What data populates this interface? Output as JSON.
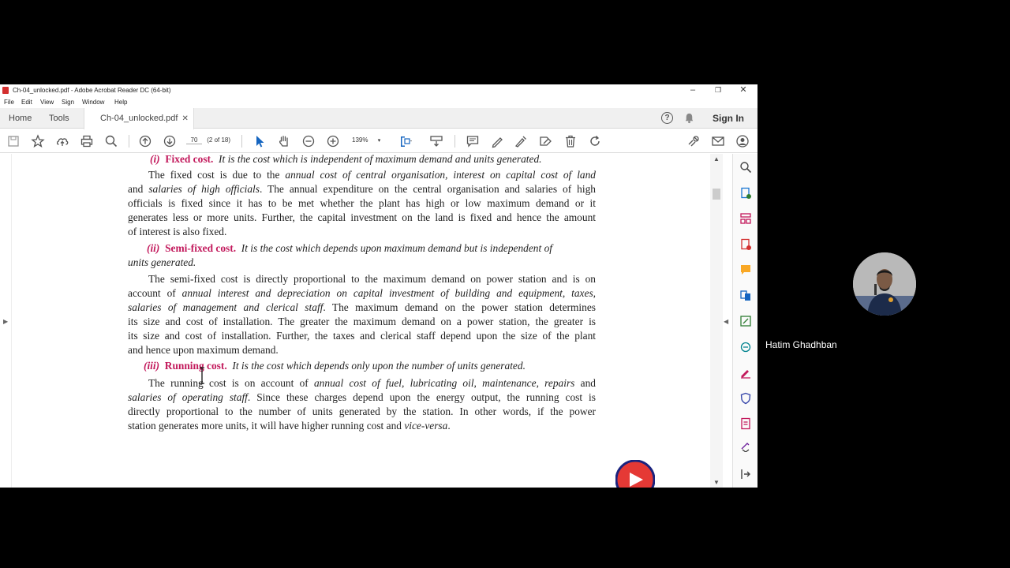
{
  "window": {
    "title": "Ch-04_unlocked.pdf - Adobe Acrobat Reader DC (64-bit)"
  },
  "menu": [
    "File",
    "Edit",
    "View",
    "Sign",
    "Window",
    "Help"
  ],
  "tabs": {
    "home": "Home",
    "tools": "Tools",
    "document": "Ch-04_unlocked.pdf",
    "sign_in": "Sign In"
  },
  "toolbar": {
    "page_number": "70",
    "page_of": "(2 of 18)",
    "zoom": "139%"
  },
  "document": {
    "fixed_heading_num": "(i)",
    "fixed_heading": "Fixed cost.",
    "fixed_def": "It is the cost which is independent of maximum demand and units generated.",
    "fixed_l1a": "The fixed cost is due to the",
    "fixed_l1b": "annual cost of central organisation, interest on capital cost of land",
    "fixed_l2a": "and",
    "fixed_l2b": "salaries of high officials",
    "fixed_l2c": ". The annual expenditure on the central organisation and salaries of high",
    "fixed_l3": "officials is fixed since it has to be met whether the plant has high or low maximum demand or it",
    "fixed_l4": "generates less or more units. Further, the capital investment on the land is fixed and hence the amount",
    "fixed_l5": "of interest is also fixed.",
    "semi_heading_num": "(ii)",
    "semi_heading": "Semi-fixed cost.",
    "semi_def1": "It is the cost which depends upon maximum demand but is independent of",
    "semi_def2": "units generated.",
    "semi_l1": "The semi-fixed cost is directly proportional to the maximum demand on power station and is on",
    "semi_l2a": "account of",
    "semi_l2b": "annual interest and depreciation on capital investment of building and equipment, taxes,",
    "semi_l3a": "salaries of management and clerical staff",
    "semi_l3b": ". The maximum demand on the power station determines",
    "semi_l4": "its size and cost of installation. The greater the maximum demand on a power station, the greater is",
    "semi_l5": "its size and cost of installation. Further, the taxes and clerical staff depend upon the size of the plant",
    "semi_l6": "and hence upon maximum demand.",
    "run_heading_num": "(iii)",
    "run_heading": "Running cost.",
    "run_def": "It is the cost which depends only upon the number of units generated.",
    "run_l1a": "The running cost is on account of",
    "run_l1b": "annual cost of fuel, lubricating oil, maintenance, repairs",
    "run_l1c": "and",
    "run_l2a": "salaries of operating staff",
    "run_l2b": ". Since these charges depend upon the energy output, the running cost is",
    "run_l3": "directly proportional to the number of units generated by the station. In other words, if the power",
    "run_l4a": "station generates more units, it will have higher running cost and",
    "run_l4b": "vice-versa",
    "run_l4c": "."
  },
  "participant": {
    "name": "Hatim Ghadhban"
  },
  "colors": {
    "heading": "#c2185b",
    "acrobat_red": "#d32f2f",
    "background": "#000000"
  }
}
